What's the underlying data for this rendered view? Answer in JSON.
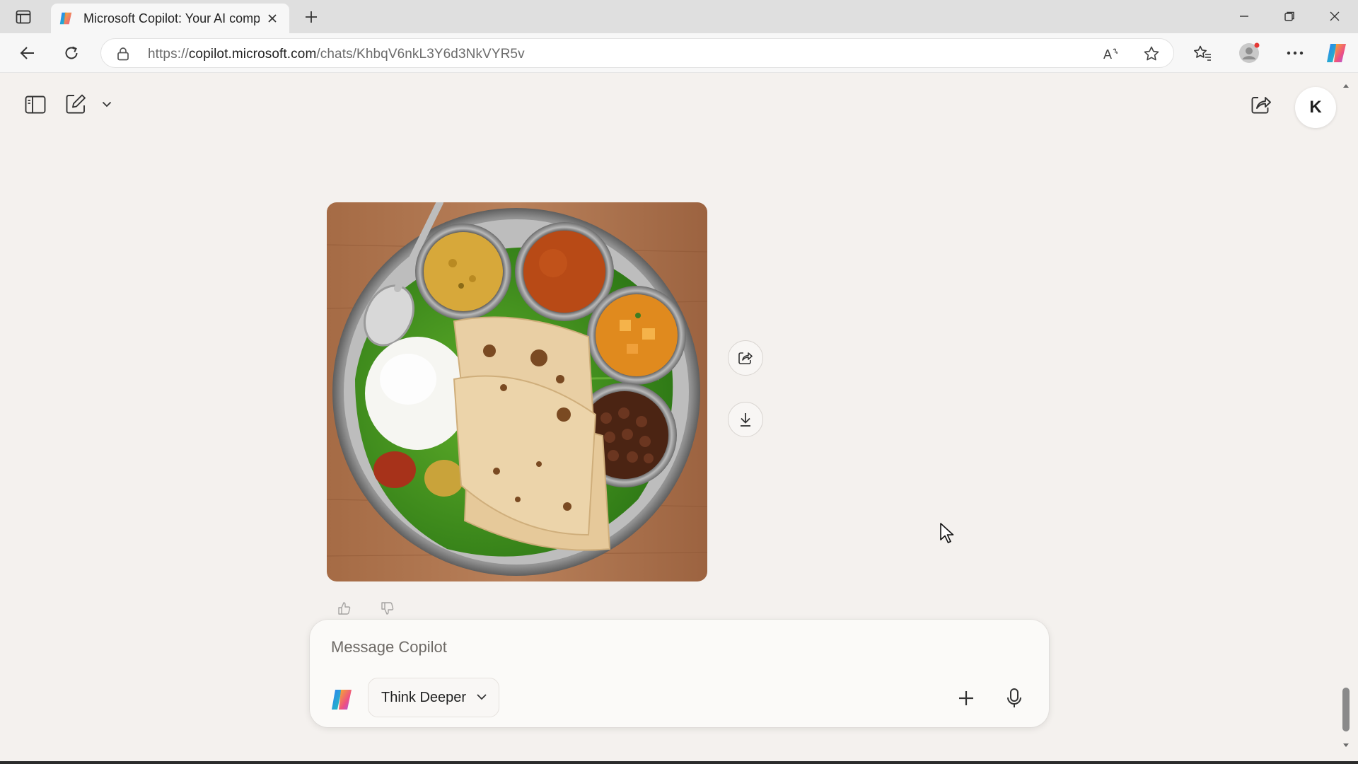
{
  "browser": {
    "tab": {
      "title": "Microsoft Copilot: Your AI compa",
      "close_icon": "close-icon"
    },
    "new_tab_icon": "plus-icon",
    "window_controls": [
      "minimize-icon",
      "restore-icon",
      "close-icon"
    ],
    "nav": {
      "back_icon": "arrow-left-icon",
      "refresh_icon": "refresh-icon"
    },
    "address": {
      "lock_icon": "lock-icon",
      "url_prefix": "https://",
      "url_host": "copilot.microsoft.com",
      "url_path": "/chats/KhbqV6nkL3Y6d3NkVYR5v"
    },
    "toolbar_icons": [
      "read-aloud-icon",
      "favorite-star-icon",
      "favorites-icon",
      "profile-icon",
      "more-icon",
      "copilot-icon"
    ]
  },
  "page": {
    "sidebar_toggle_icon": "sidebar-icon",
    "new_chat_icon": "compose-icon",
    "dropdown_icon": "chevron-down-icon",
    "share_icon": "share-icon",
    "avatar_initial": "K",
    "image_actions": [
      "share-icon",
      "download-icon"
    ],
    "feedback_icons": [
      "thumbs-up-icon",
      "thumbs-down-icon"
    ]
  },
  "composer": {
    "placeholder": "Message Copilot",
    "mode_label": "Think Deeper",
    "add_icon": "plus-icon",
    "mic_icon": "microphone-icon"
  },
  "colors": {
    "page_background": "#f4f1ee",
    "tabbar": "#dfdfdf",
    "composer": "#fbfaf8"
  }
}
